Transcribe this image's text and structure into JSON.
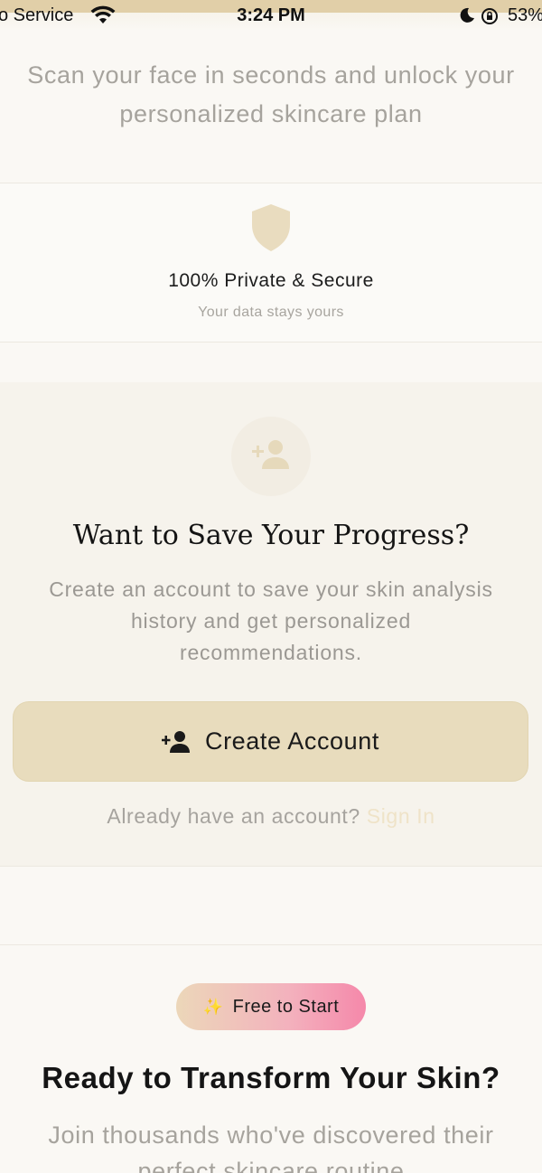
{
  "status_bar": {
    "carrier": "o Service",
    "time": "3:24 PM",
    "battery": "53%"
  },
  "intro": {
    "subtitle_line1": "Scan your face in seconds and unlock your",
    "subtitle_line2": "personalized skincare plan"
  },
  "privacy": {
    "icon": "shield-icon",
    "title": "100% Private & Secure",
    "subtitle": "Your data stays yours"
  },
  "save_progress": {
    "icon": "add-user-icon",
    "title": "Want to Save Your Progress?",
    "desc_line1": "Create an account to save your skin analysis",
    "desc_line2": "history and get personalized",
    "desc_line3": "recommendations.",
    "create_button_label": "Create Account",
    "signin_prompt": "Already have an account?",
    "signin_link": "Sign In"
  },
  "cta": {
    "badge_icon": "✨",
    "badge_label": "Free to Start",
    "title": "Ready to Transform Your Skin?",
    "desc_line1": "Join thousands who've discovered their",
    "desc_line2": "perfect skincare routine"
  },
  "colors": {
    "background": "#faf8f4",
    "card_background": "#f6f3ec",
    "accent_beige": "#e8dcbd",
    "pink_accent": "#f588aa",
    "muted_text": "#a6a39d"
  }
}
